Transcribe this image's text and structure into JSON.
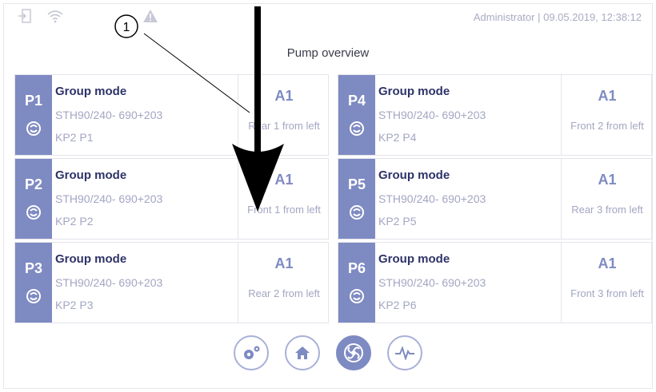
{
  "header": {
    "user": "Administrator",
    "separator": "|",
    "datetime": "09.05.2019, 12:38:12",
    "status_icons": [
      "login-icon",
      "wifi-icon",
      "warning-icon"
    ]
  },
  "page_title": "Pump overview",
  "pumps": [
    {
      "label": "P1",
      "mode": "Group mode",
      "model": "STH90/240- 690+203",
      "id": "KP2 P1",
      "group": "A1",
      "location": "Rear 1 from left"
    },
    {
      "label": "P2",
      "mode": "Group mode",
      "model": "STH90/240- 690+203",
      "id": "KP2 P2",
      "group": "A1",
      "location": "Front 1 from left"
    },
    {
      "label": "P3",
      "mode": "Group mode",
      "model": "STH90/240- 690+203",
      "id": "KP2 P3",
      "group": "A1",
      "location": "Rear 2 from left"
    },
    {
      "label": "P4",
      "mode": "Group mode",
      "model": "STH90/240- 690+203",
      "id": "KP2 P4",
      "group": "A1",
      "location": "Front 2 from left"
    },
    {
      "label": "P5",
      "mode": "Group mode",
      "model": "STH90/240- 690+203",
      "id": "KP2 P5",
      "group": "A1",
      "location": "Rear 3 from left"
    },
    {
      "label": "P6",
      "mode": "Group mode",
      "model": "STH90/240- 690+203",
      "id": "KP2 P6",
      "group": "A1",
      "location": "Front 3 from left"
    }
  ],
  "nav": [
    "settings-icon",
    "home-icon",
    "pump-icon",
    "chart-icon"
  ],
  "callout": {
    "number": "1"
  },
  "colors": {
    "accent": "#7e8ac2",
    "text_dark": "#2e3368",
    "text_muted": "#a3a6c3"
  }
}
